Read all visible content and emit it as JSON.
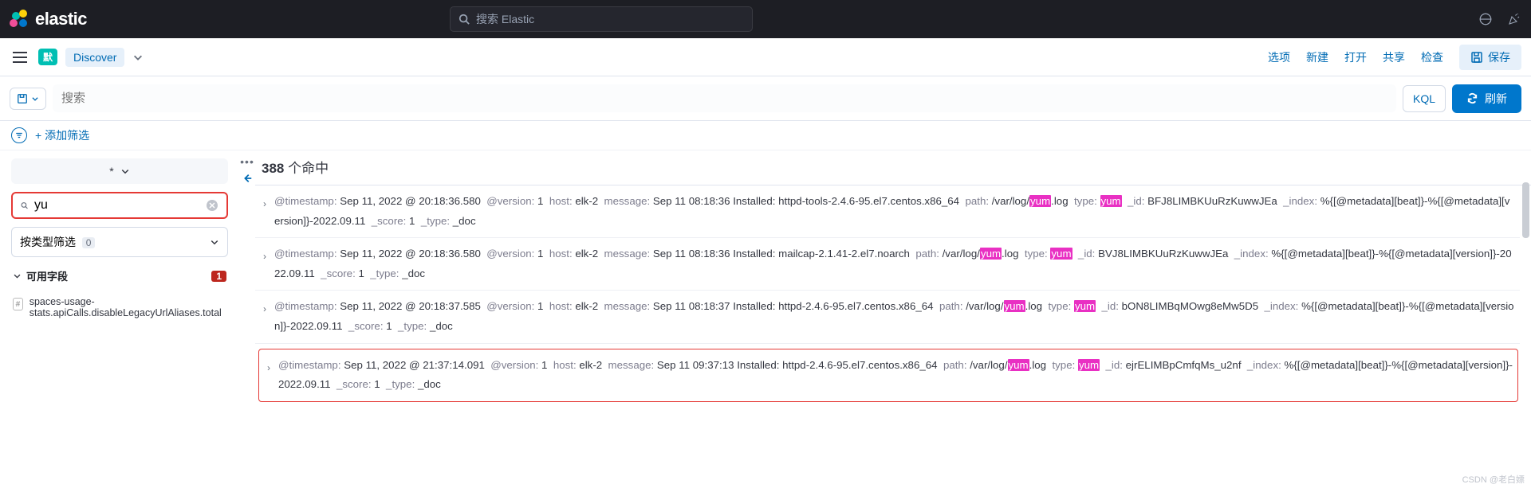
{
  "brand": "elastic",
  "global_search_placeholder": "搜索 Elastic",
  "app": {
    "default_badge": "默",
    "name": "Discover",
    "actions": {
      "options": "选项",
      "new": "新建",
      "open": "打开",
      "share": "共享",
      "inspect": "检查",
      "save": "保存"
    }
  },
  "query": {
    "placeholder": "搜索",
    "kql": "KQL",
    "refresh": "刷新"
  },
  "filter": {
    "add": "+ 添加筛选"
  },
  "sidebar": {
    "index_pattern": "*",
    "field_search_value": "yu",
    "type_filter_label": "按类型筛选",
    "type_filter_count": "0",
    "available_fields_label": "可用字段",
    "available_fields_count": "1",
    "field_item": "spaces-usage-stats.apiCalls.disableLegacyUrlAliases.total"
  },
  "hits": {
    "count": "388",
    "suffix": "个命中"
  },
  "docs": [
    {
      "ts": "Sep 11, 2022 @ 20:18:36.580",
      "ver": "1",
      "host": "elk-2",
      "msg": "Sep 11 08:18:36 Installed: httpd-tools-2.4.6-95.el7.centos.x86_64",
      "path_pre": "/var/log/",
      "path_hl": "yum",
      "path_post": ".log",
      "type_hl": "yum",
      "id": "BFJ8LIMBKUuRzKuwwJEa",
      "index": "%{[@metadata][beat]}-%{[@metadata][version]}-2022.09.11",
      "score": "1",
      "dtype": "_doc",
      "highlighted": false
    },
    {
      "ts": "Sep 11, 2022 @ 20:18:36.580",
      "ver": "1",
      "host": "elk-2",
      "msg": "Sep 11 08:18:36 Installed: mailcap-2.1.41-2.el7.noarch",
      "path_pre": "/var/log/",
      "path_hl": "yum",
      "path_post": ".log",
      "type_hl": "yum",
      "id": "BVJ8LIMBKUuRzKuwwJEa",
      "index": "%{[@metadata][beat]}-%{[@metadata][version]}-2022.09.11",
      "score": "1",
      "dtype": "_doc",
      "highlighted": false
    },
    {
      "ts": "Sep 11, 2022 @ 20:18:37.585",
      "ver": "1",
      "host": "elk-2",
      "msg": "Sep 11 08:18:37 Installed: httpd-2.4.6-95.el7.centos.x86_64",
      "path_pre": "/var/log/",
      "path_hl": "yum",
      "path_post": ".log",
      "type_hl": "yum",
      "id": "bON8LIMBqMOwg8eMw5D5",
      "index": "%{[@metadata][beat]}-%{[@metadata][version]}-2022.09.11",
      "score": "1",
      "dtype": "_doc",
      "highlighted": false
    },
    {
      "ts": "Sep 11, 2022 @ 21:37:14.091",
      "ver": "1",
      "host": "elk-2",
      "msg": "Sep 11 09:37:13 Installed: httpd-2.4.6-95.el7.centos.x86_64",
      "path_pre": "/var/log/",
      "path_hl": "yum",
      "path_post": ".log",
      "type_hl": "yum",
      "id": "ejrELIMBpCmfqMs_u2nf",
      "index": "%{[@metadata][beat]}-%{[@metadata][version]}-2022.09.11",
      "score": "1",
      "dtype": "_doc",
      "highlighted": true
    }
  ],
  "watermark": "CSDN @老白嫖"
}
